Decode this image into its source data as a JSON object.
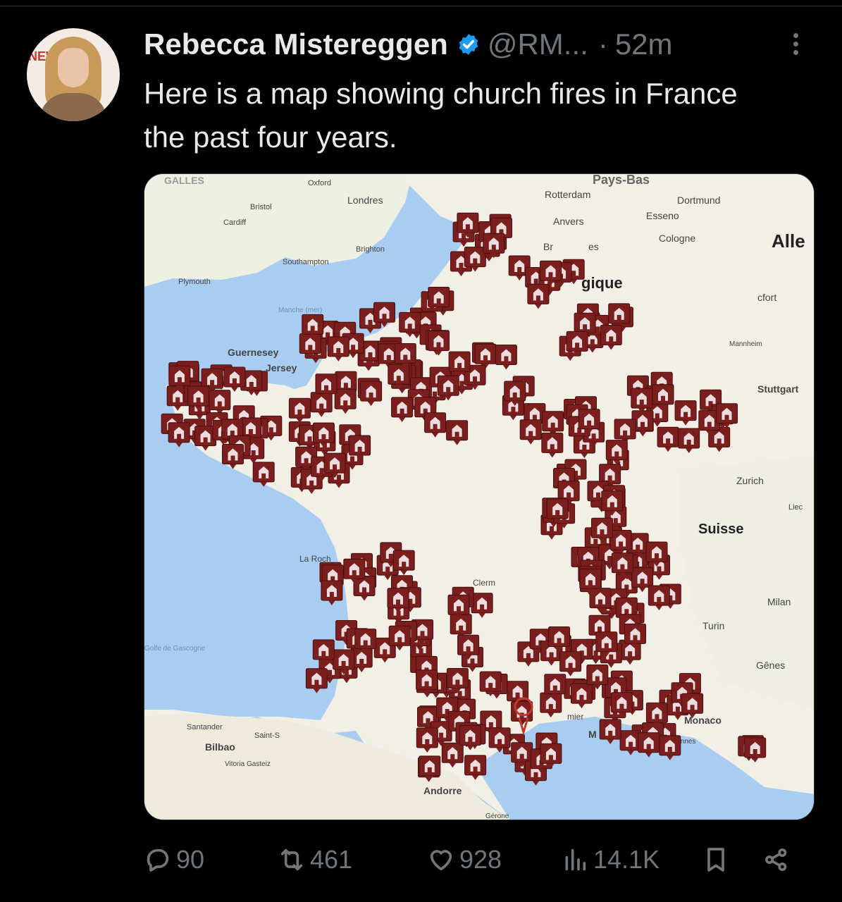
{
  "tweet": {
    "author_name": "Rebecca Mistereggen",
    "handle": "@RM...",
    "separator": "·",
    "time": "52m",
    "text": "Here is a map showing church fires in France the past four years.",
    "verified_color": "#1d9bf0"
  },
  "avatar": {
    "background_text": "NEW"
  },
  "map": {
    "labels": {
      "galles": "GALLES",
      "oxford": "Oxford",
      "londres": "Londres",
      "bristol": "Bristol",
      "cardiff": "Cardiff",
      "brighton": "Brighton",
      "southampton": "Southampton",
      "plymouth": "Plymouth",
      "manche": "Manche (mer)",
      "guernesey": "Guernesey",
      "jersey": "Jersey",
      "paysbas": "Pays-Bas",
      "rotterdam": "Rotterdam",
      "anvers": "Anvers",
      "dortmund": "Dortmund",
      "esseno": "Esseno",
      "cologne": "Cologne",
      "bruxelles": "Br",
      "bruxelles2": "es",
      "belgique": "gique",
      "alle": "Alle",
      "francfort": "cfort",
      "mannheim": "Mannheim",
      "stuttgart": "Stuttgart",
      "zurich": "Zurich",
      "suisse": "Suisse",
      "lie": "Liec",
      "milan": "Milan",
      "turin": "Turin",
      "genes": "Gênes",
      "monaco": "Monaco",
      "cannes": "Cannes",
      "larochelle": "La Roch",
      "santander": "Santander",
      "bilbao": "Bilbao",
      "vitoria": "Vitoria Gasteiz",
      "saint": "Saint-S",
      "andorre": "Andorre",
      "gerone": "Gérone",
      "golfe": "Golfe de Gascogne",
      "clerm": "Clerm",
      "m": "M",
      "mier": "mier"
    }
  },
  "actions": {
    "replies": "90",
    "reposts": "461",
    "likes": "928",
    "views": "14.1K"
  }
}
